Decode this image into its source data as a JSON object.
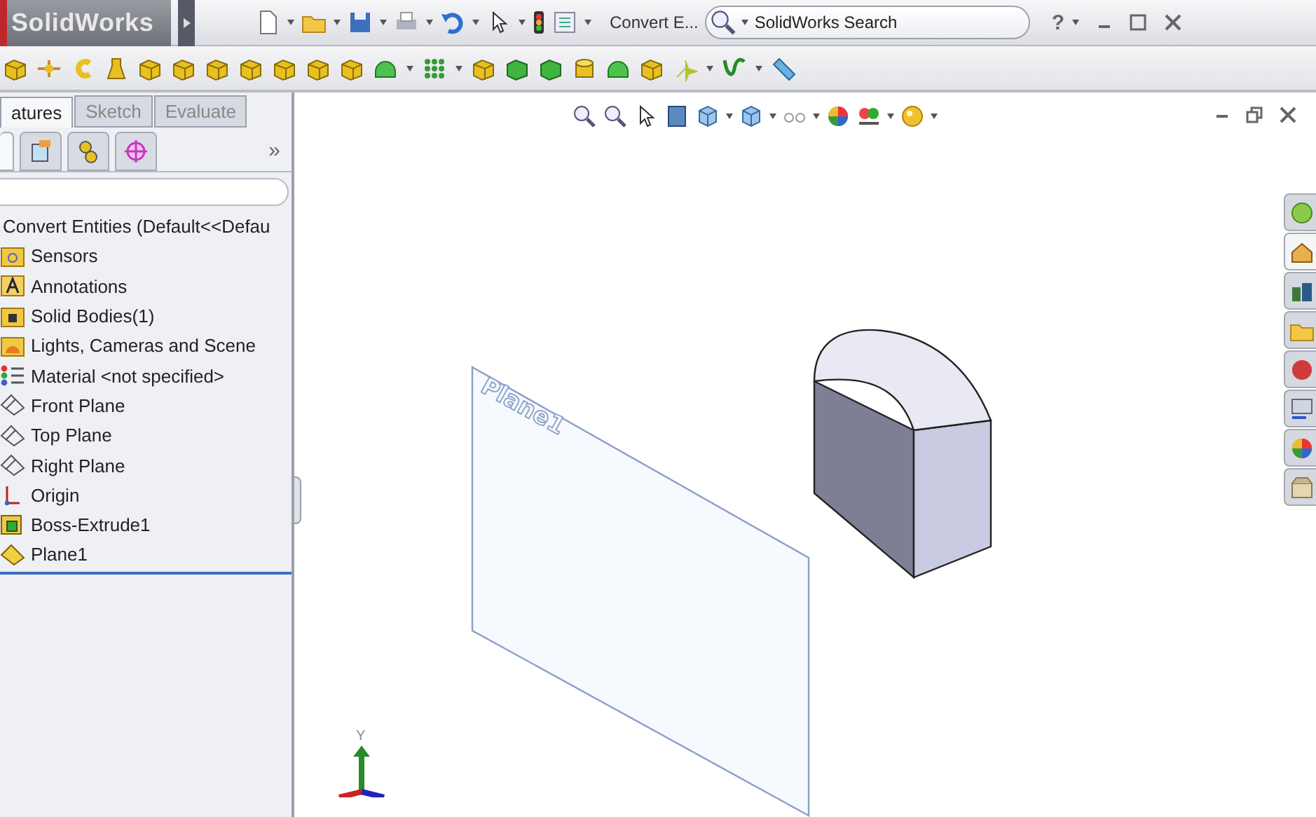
{
  "title_bar": {
    "app_name": "SolidWorks",
    "document_name": "Convert E...",
    "search": {
      "placeholder": "SolidWorks Search"
    },
    "help": "?"
  },
  "panel": {
    "tabs": [
      {
        "label": "atures",
        "selected": true
      },
      {
        "label": "Sketch",
        "selected": false
      },
      {
        "label": "Evaluate",
        "selected": false
      }
    ],
    "icon_tabs": [
      {
        "selected": true
      },
      {
        "selected": false
      },
      {
        "selected": false
      },
      {
        "selected": false
      }
    ],
    "more": "»",
    "tree": {
      "label": "Convert Entities  (Default<<Defau",
      "children": [
        {
          "label": "Sensors",
          "kind": "sensors"
        },
        {
          "label": "Annotations",
          "kind": "annotations"
        },
        {
          "label": "Solid Bodies(1)",
          "kind": "bodies"
        },
        {
          "label": "Lights, Cameras and Scene",
          "kind": "lights"
        },
        {
          "label": "Material <not specified>",
          "kind": "material"
        },
        {
          "label": "Front Plane",
          "kind": "plane"
        },
        {
          "label": "Top Plane",
          "kind": "plane"
        },
        {
          "label": "Right Plane",
          "kind": "plane"
        },
        {
          "label": "Origin",
          "kind": "origin"
        },
        {
          "label": "Boss-Extrude1",
          "kind": "extrude"
        },
        {
          "label": "Plane1",
          "kind": "refplane"
        }
      ]
    }
  },
  "viewport": {
    "plane_label": "Plane1",
    "axis_label": "Y"
  }
}
